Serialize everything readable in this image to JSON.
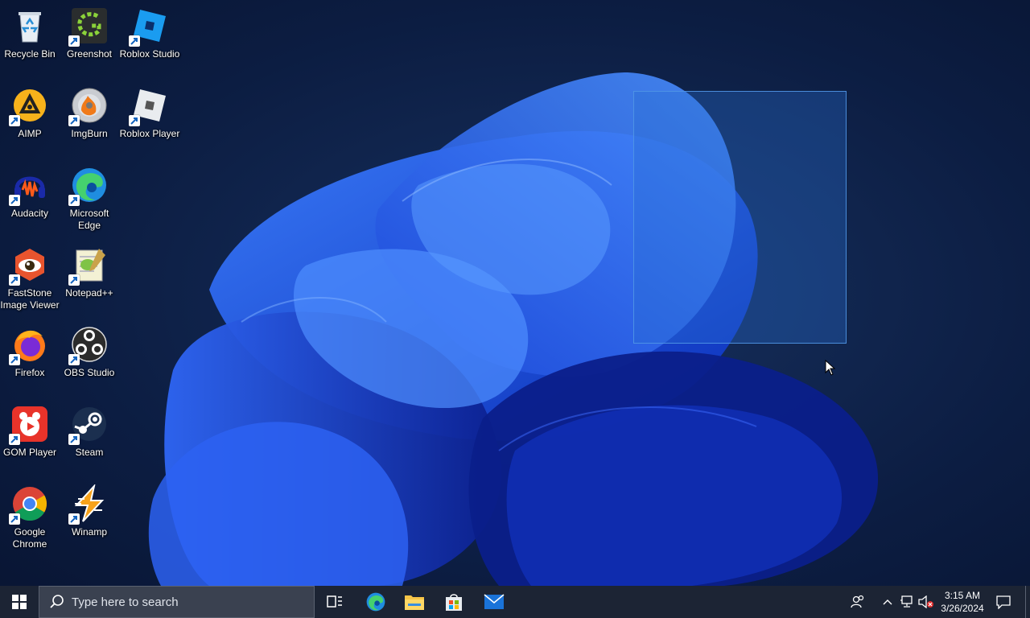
{
  "desktop": {
    "icons": [
      {
        "label": "Recycle Bin",
        "icon": "recycle-bin-icon"
      },
      {
        "label": "Greenshot",
        "icon": "greenshot-icon"
      },
      {
        "label": "Roblox Studio",
        "icon": "roblox-studio-icon"
      },
      {
        "label": "AIMP",
        "icon": "aimp-icon"
      },
      {
        "label": "ImgBurn",
        "icon": "imgburn-icon"
      },
      {
        "label": "Roblox Player",
        "icon": "roblox-player-icon"
      },
      {
        "label": "Audacity",
        "icon": "audacity-icon"
      },
      {
        "label": "Microsoft Edge",
        "icon": "edge-icon"
      },
      {
        "label": "FastStone Image Viewer",
        "icon": "faststone-icon"
      },
      {
        "label": "Notepad++",
        "icon": "notepadpp-icon"
      },
      {
        "label": "Firefox",
        "icon": "firefox-icon"
      },
      {
        "label": "OBS Studio",
        "icon": "obs-icon"
      },
      {
        "label": "GOM Player",
        "icon": "gom-player-icon"
      },
      {
        "label": "Steam",
        "icon": "steam-icon"
      },
      {
        "label": "Google Chrome",
        "icon": "chrome-icon"
      },
      {
        "label": "Winamp",
        "icon": "winamp-icon"
      }
    ]
  },
  "taskbar": {
    "search_placeholder": "Type here to search",
    "pinned": [
      "task-view-icon",
      "edge-icon",
      "file-explorer-icon",
      "microsoft-store-icon",
      "mail-icon"
    ],
    "clock_time": "3:15 AM",
    "clock_date": "3/26/2024"
  },
  "colors": {
    "accent": "#1f6feb",
    "taskbar": "#1c2434",
    "selection_fill": "#286ed2"
  }
}
